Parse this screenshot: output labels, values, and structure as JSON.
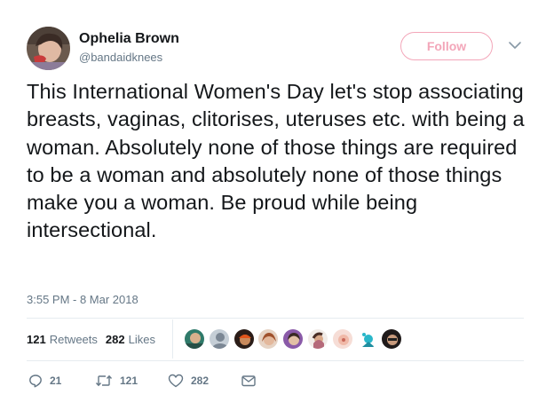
{
  "user": {
    "name": "Ophelia Brown",
    "handle": "@bandaidknees",
    "follow_label": "Follow"
  },
  "tweet": {
    "text": "This International Women's Day let's stop associating breasts, vaginas, clitorises, uteruses etc. with being a woman. Absolutely none of those things are required to be a woman and absolutely none of those things make you a woman. Be proud while being intersectional.",
    "timestamp": "3:55 PM - 8 Mar 2018"
  },
  "stats": {
    "retweets_count": "121",
    "retweets_label": "Retweets",
    "likes_count": "282",
    "likes_label": "Likes"
  },
  "actions": {
    "reply_count": "21",
    "retweet_count": "121",
    "like_count": "282"
  },
  "colors": {
    "follow_accent": "#f3a6b9",
    "muted_text": "#657786",
    "divider": "#e6ecf0"
  },
  "icons": {
    "caret": "chevron-down-icon",
    "reply": "reply-icon",
    "retweet": "retweet-icon",
    "like": "heart-icon",
    "dm": "envelope-icon"
  }
}
